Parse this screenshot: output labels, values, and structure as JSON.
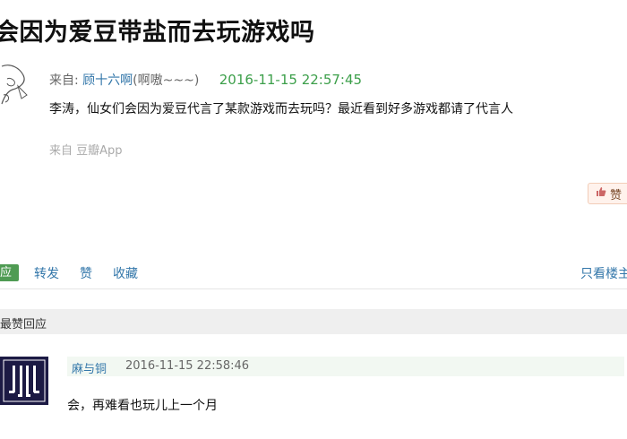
{
  "post": {
    "title": "会因为爱豆带盐而去玩游戏吗",
    "from_label": "来自:",
    "author_name": "顾十六啊",
    "author_signature": "(啊嗷~~~)",
    "timestamp": "2016-11-15 22:57:45",
    "body": "李涛，仙女们会因为爱豆代言了某款游戏而去玩吗？最近看到好多游戏都请了代言人",
    "source": "来自 豆瓣App",
    "like_label": "赞"
  },
  "actions": {
    "reply": "应",
    "share": "转发",
    "like": "赞",
    "favorite": "收藏",
    "only_op": "只看楼主"
  },
  "section": {
    "title": "最赞回应"
  },
  "reply": {
    "author": "麻与铜",
    "timestamp": "2016-11-15 22:58:46",
    "body": "会，再难看也玩儿上一个月"
  },
  "colors": {
    "link": "#3377aa",
    "time_green": "#3c9f4a",
    "reply_button": "#4f9b53",
    "section_bg": "#efefef",
    "reply_head_bg": "#f2f8f2"
  }
}
